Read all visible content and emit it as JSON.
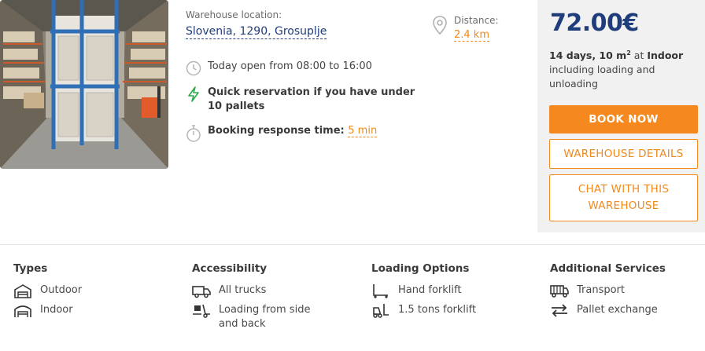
{
  "listing": {
    "location_label": "Warehouse location:",
    "location_value": "Slovenia, 1290, Grosuplje",
    "hours": "Today open from 08:00 to 16:00",
    "quick_reservation": "Quick reservation if you have under 10 pallets",
    "response_label": "Booking response time:",
    "response_value": "5 min",
    "distance_label": "Distance:",
    "distance_value": "2.4 km"
  },
  "pricing": {
    "price": "72.00€",
    "duration": "14 days, 10 m",
    "area_sup": "2",
    "at": "at",
    "type": "Indoor",
    "includes": "including loading and unloading",
    "book_label": "BOOK NOW",
    "details_label": "WAREHOUSE DETAILS",
    "chat_label": "CHAT WITH THIS WAREHOUSE"
  },
  "features": {
    "types": {
      "title": "Types",
      "items": [
        "Outdoor",
        "Indoor"
      ]
    },
    "accessibility": {
      "title": "Accessibility",
      "items": [
        "All trucks",
        "Loading from side and back"
      ]
    },
    "loading": {
      "title": "Loading Options",
      "items": [
        "Hand forklift",
        "1.5 tons forklift"
      ]
    },
    "services": {
      "title": "Additional Services",
      "items": [
        "Transport",
        "Pallet exchange"
      ]
    }
  },
  "colors": {
    "accent": "#f5891f",
    "brand": "#1f3d7a",
    "price_panel": "#f1f1f1",
    "lightning": "#2aa84a"
  },
  "icons": {
    "hours": "clock-icon",
    "quick": "lightning-icon",
    "response": "stopwatch-icon",
    "distance": "location-pin-icon"
  }
}
